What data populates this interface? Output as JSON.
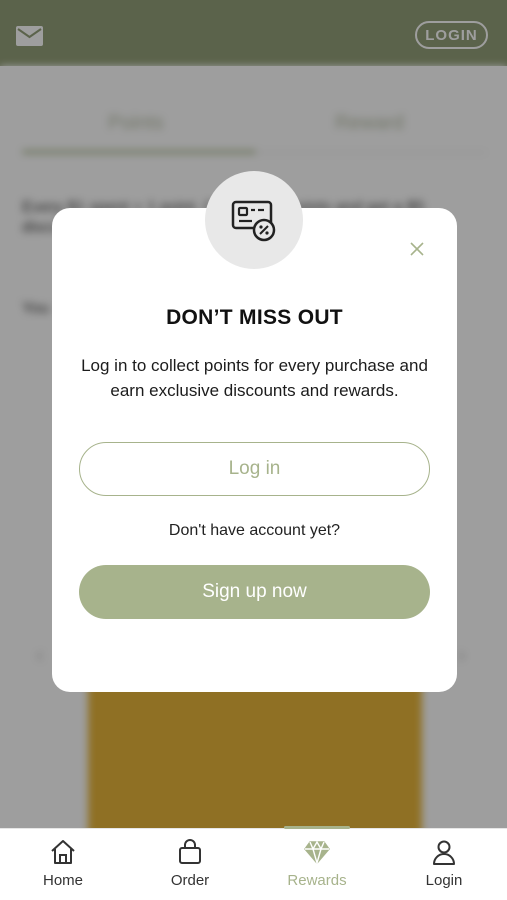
{
  "header": {
    "login_label": "LOGIN"
  },
  "background": {
    "tabs": [
      "Points",
      "Reward"
    ],
    "text_line": "Every $1 spent = 1 point. Collect 100 points and get a $5 discount",
    "text_line2": "You"
  },
  "modal": {
    "title": "DON’T MISS OUT",
    "body": "Log in to collect points for every purchase and earn exclusive discounts and rewards.",
    "login_button": "Log in",
    "no_account_text": "Don't have account yet?",
    "signup_button": "Sign up now"
  },
  "nav": {
    "items": [
      {
        "label": "Home",
        "icon": "home-icon"
      },
      {
        "label": "Order",
        "icon": "bag-icon"
      },
      {
        "label": "Rewards",
        "icon": "diamond-icon"
      },
      {
        "label": "Login",
        "icon": "user-icon"
      }
    ],
    "active_index": 2
  },
  "colors": {
    "header": "#94a079",
    "accent": "#a7b38c",
    "card": "#e7b53a"
  }
}
